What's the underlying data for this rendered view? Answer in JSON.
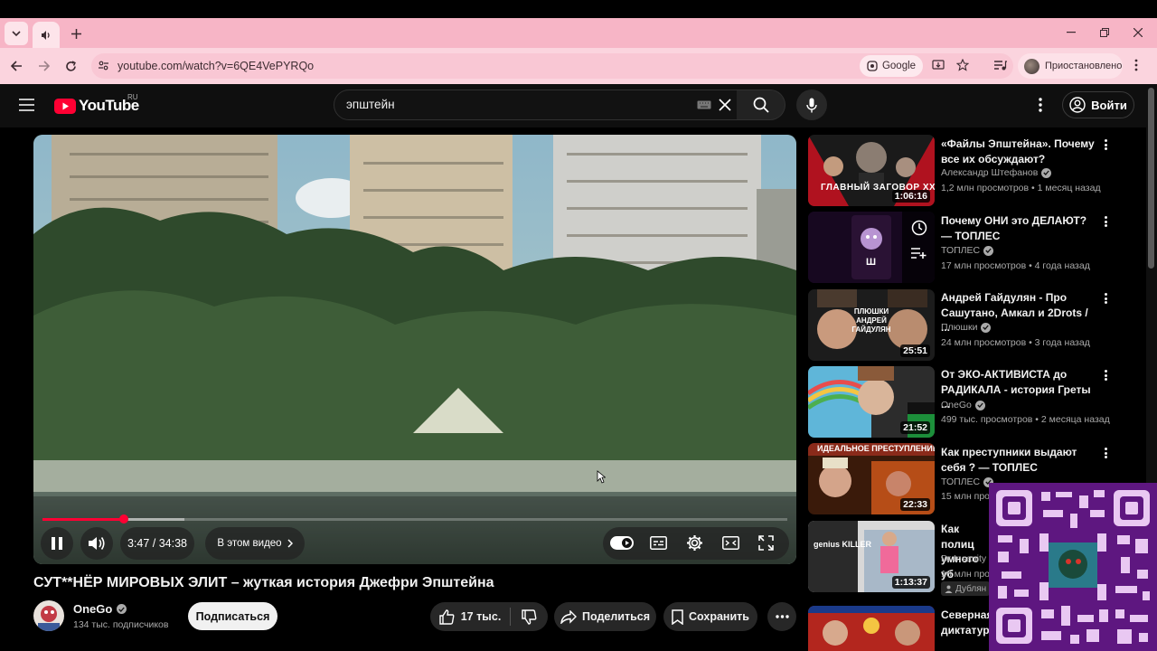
{
  "browser": {
    "url": "youtube.com/watch?v=6QE4VePYRQo",
    "google_chip": "Google",
    "profile_label": "Приостановлено"
  },
  "header": {
    "logo": "YouTube",
    "logo_region": "RU",
    "search_value": "эпштейн",
    "signin_label": "Войти"
  },
  "player": {
    "time_current": "3:47",
    "time_total": "34:38",
    "time_display": "3:47 / 34:38",
    "chapters_label": "В этом видео",
    "progress_fraction": 0.109,
    "buffered_fraction": 0.19
  },
  "video": {
    "title": "СУТ**НЁР МИРОВЫХ ЭЛИТ – жуткая история Джефри Эпштейна",
    "channel": "OneGo",
    "subscribers": "134 тыс. подписчиков",
    "subscribe_label": "Подписаться",
    "likes": "17 тыс.",
    "share_label": "Поделиться",
    "save_label": "Сохранить"
  },
  "recommendations": [
    {
      "title": "«Файлы Эпштейна». Почему все их обсуждают?",
      "channel": "Александр Штефанов",
      "meta": "1,2 млн просмотров • 1 месяц назад",
      "duration": "1:06:16",
      "thumb_text": "ГЛАВНЫЙ ЗАГОВОР XXI ВЕКА"
    },
    {
      "title": "Почему ОНИ это ДЕЛАЮТ? — ТОПЛЕС",
      "channel": "ТОПЛЕС",
      "meta": "17 млн просмотров • 4 года назад",
      "duration": "",
      "thumb_text": "Ш"
    },
    {
      "title": "Андрей Гайдулян - Про Сашутано, Амкал и 2Drots / ...",
      "channel": "Плюшки",
      "meta": "24 млн просмотров • 3 года назад",
      "duration": "25:51",
      "thumb_text": "ПЛЮШКИ АНДРЕЙ ГАЙДУЛЯН"
    },
    {
      "title": "От ЭКО-АКТИВИСТА до РАДИКАЛА - история Греты ...",
      "channel": "OneGo",
      "meta": "499 тыс. просмотров • 2 месяца назад",
      "duration": "21:52",
      "thumb_text": ""
    },
    {
      "title": "Как преступники выдают себя ? — ТОПЛЕС",
      "channel": "ТОПЛЕС",
      "meta": "15 млн про",
      "duration": "22:33",
      "thumb_text": "ИДЕАЛЬНОЕ ПРЕСТУПЛЕНИЕ"
    },
    {
      "title": "Как полиц умного уб",
      "channel": "Dr Insanity",
      "meta": "16 млн про",
      "meta2": "Дублян",
      "duration": "1:13:37",
      "thumb_text": "genius KILLER"
    },
    {
      "title": "Северная диктатур",
      "channel": "",
      "meta": "",
      "duration": "",
      "thumb_text": ""
    }
  ],
  "colors": {
    "tab_bar": "#f7b5c6",
    "address_bar": "#fbd4de",
    "youtube_bg": "#0f0f0f",
    "progress_red": "#ff0033"
  }
}
